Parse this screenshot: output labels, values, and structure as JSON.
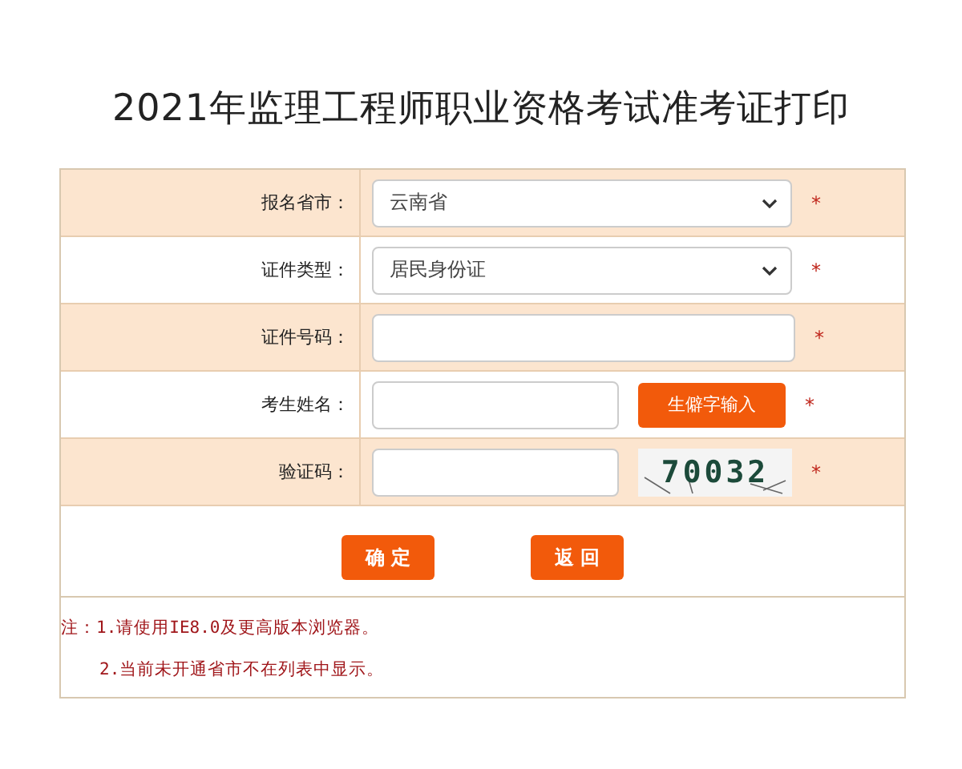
{
  "title": "2021年监理工程师职业资格考试准考证打印",
  "rows": [
    {
      "kind": "select",
      "label": "报名省市：",
      "value": "云南省",
      "required": "*",
      "shaded": true
    },
    {
      "kind": "select",
      "label": "证件类型：",
      "value": "居民身份证",
      "required": "*",
      "shaded": false
    },
    {
      "kind": "input",
      "label": "证件号码：",
      "required": "*",
      "shaded": true
    },
    {
      "kind": "input_button",
      "label": "考生姓名：",
      "button": "生僻字输入",
      "required": "*",
      "shaded": false
    },
    {
      "kind": "input_captcha",
      "label": "验证码：",
      "captcha": "70032",
      "required": "*",
      "shaded": true
    }
  ],
  "buttons": [
    "确 定",
    "返 回"
  ],
  "notes": [
    "注：1.请使用IE8.0及更高版本浏览器。",
    "2.当前未开通省市不在列表中显示。"
  ]
}
